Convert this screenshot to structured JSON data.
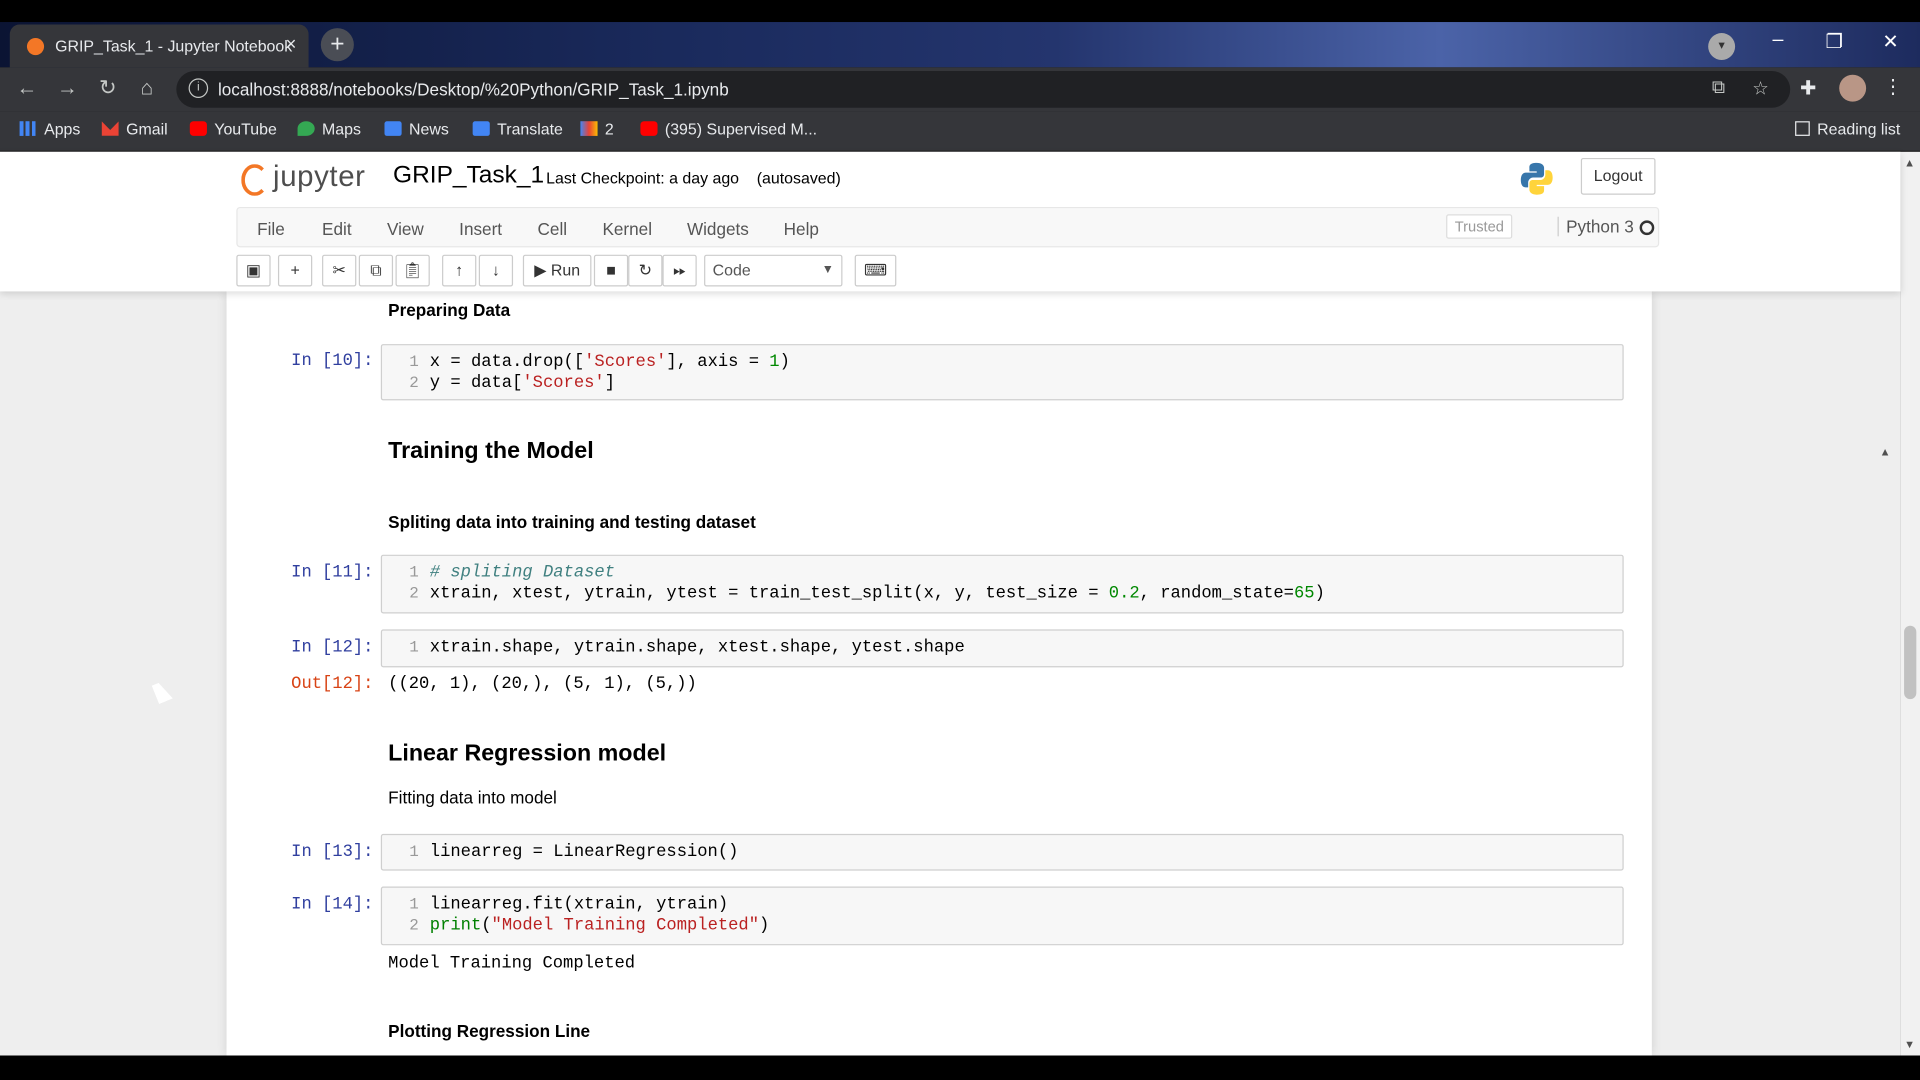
{
  "browser": {
    "tab_title": "GRIP_Task_1 - Jupyter Notebook",
    "tab_close": "×",
    "new_tab": "+",
    "url": "localhost:8888/notebooks/Desktop/%20Python/GRIP_Task_1.ipynb",
    "bookmarks": [
      "Apps",
      "Gmail",
      "YouTube",
      "Maps",
      "News",
      "Translate",
      "2",
      "(395) Supervised M..."
    ],
    "reading_list": "Reading list",
    "win_min": "–",
    "win_max": "❐",
    "win_close": "✕"
  },
  "jupyter": {
    "logo_text": "jupyter",
    "notebook_name": "GRIP_Task_1",
    "checkpoint": "Last Checkpoint: a day ago",
    "autosaved": "(autosaved)",
    "logout": "Logout",
    "menu": [
      "File",
      "Edit",
      "View",
      "Insert",
      "Cell",
      "Kernel",
      "Widgets",
      "Help"
    ],
    "trusted": "Trusted",
    "kernel": "Python 3",
    "run": "Run",
    "cell_type": "Code"
  },
  "cells": {
    "h_preparing": "Preparing Data",
    "p10": "In [10]:",
    "c10_1": "x = data.drop(['Scores'], axis = 1)",
    "c10_2": "y = data['Scores']",
    "h_training": "Training the Model",
    "h_spliting": "Spliting data into training and testing dataset",
    "p11": "In [11]:",
    "c11_1": "# spliting Dataset",
    "c11_2": "xtrain, xtest, ytrain, ytest = train_test_split(x, y, test_size = 0.2, random_state=65)",
    "p12": "In [12]:",
    "c12_1": "xtrain.shape, ytrain.shape, xtest.shape, ytest.shape",
    "o12": "Out[12]:",
    "out12": "((20, 1), (20,), (5, 1), (5,))",
    "h_linear": "Linear Regression model",
    "p_fitting": "Fitting data into model",
    "p13": "In [13]:",
    "c13_1": "linearreg = LinearRegression()",
    "p14": "In [14]:",
    "c14_1": "linearreg.fit(xtrain, ytrain)",
    "c14_2": "print(\"Model Training Completed\")",
    "out14": "Model Training Completed",
    "h_plotting": "Plotting Regression Line"
  }
}
